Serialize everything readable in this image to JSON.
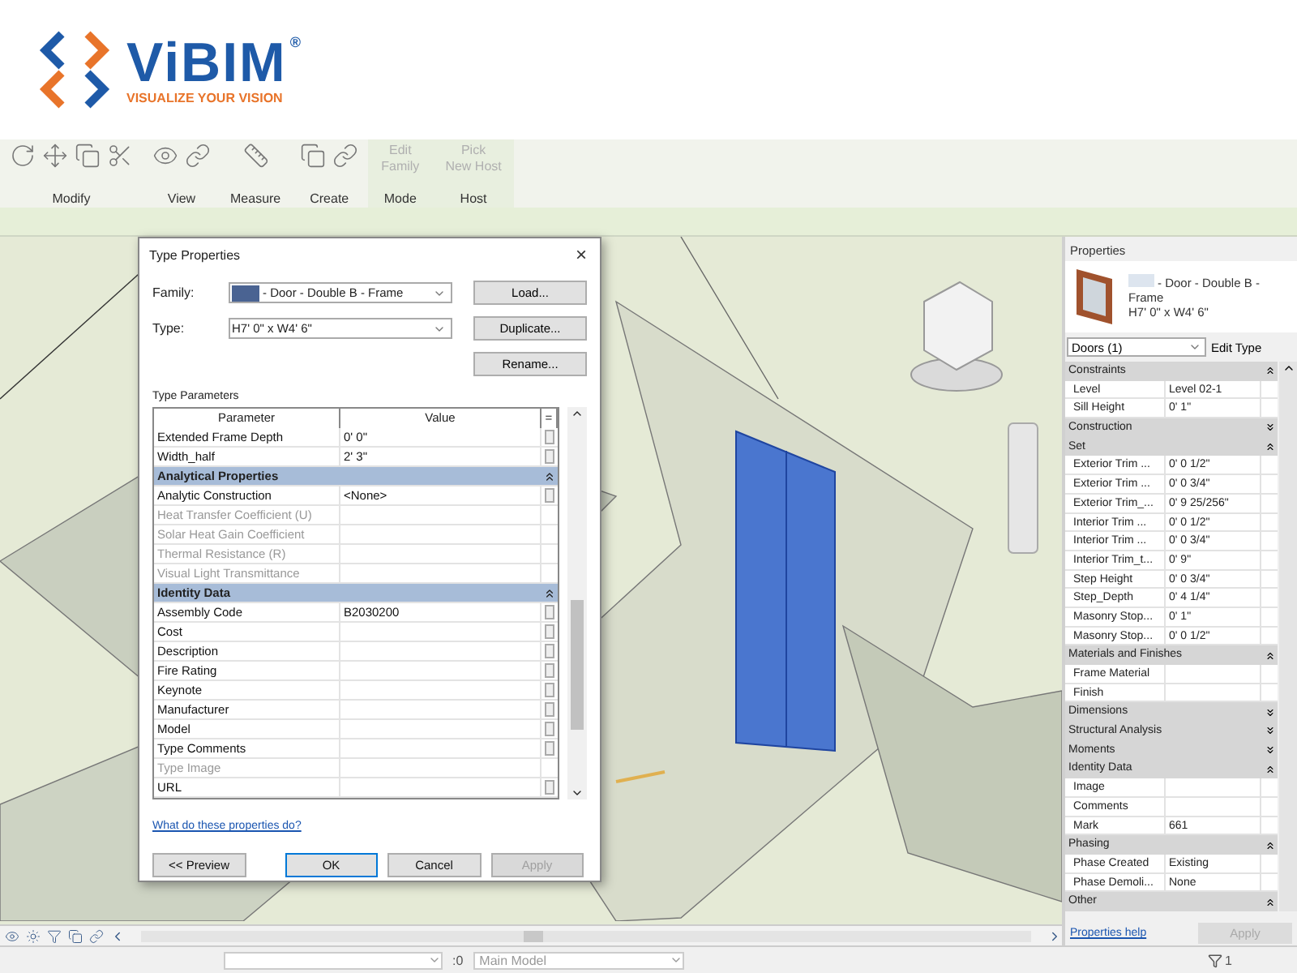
{
  "logo": {
    "name": "ViBIM",
    "mark": "®",
    "tagline": "VISUALIZE YOUR VISION"
  },
  "ribbon": {
    "groups": [
      {
        "label": "Modify",
        "kind": "tools"
      },
      {
        "label": "View",
        "kind": "tools"
      },
      {
        "label": "Measure",
        "kind": "tools"
      },
      {
        "label": "Create",
        "kind": "tools"
      },
      {
        "label": "Mode",
        "kind": "command",
        "button": [
          "Edit",
          "Family"
        ],
        "disabled": true
      },
      {
        "label": "Host",
        "kind": "command",
        "button": [
          "Pick",
          "New Host"
        ],
        "disabled": true
      }
    ]
  },
  "dialog": {
    "title": "Type Properties",
    "close": "×",
    "family": {
      "label": "Family:",
      "value": "- Door - Double B - Frame"
    },
    "type": {
      "label": "Type:",
      "value": "H7' 0\" x W4' 6\""
    },
    "side_buttons": [
      "Load...",
      "Duplicate...",
      "Rename..."
    ],
    "section": "Type Parameters",
    "columns": [
      "Parameter",
      "Value",
      "="
    ],
    "rows": [
      {
        "kind": "param",
        "name": "Extended Frame Depth",
        "value": "0'  0\"",
        "disabled": false
      },
      {
        "kind": "param",
        "name": "Width_half",
        "value": "2'  3\"",
        "disabled": false
      },
      {
        "kind": "group",
        "name": "Analytical Properties",
        "expanded": true
      },
      {
        "kind": "param",
        "name": "Analytic Construction",
        "value": "<None>",
        "disabled": false
      },
      {
        "kind": "param",
        "name": "Heat Transfer Coefficient (U)",
        "value": "",
        "disabled": true
      },
      {
        "kind": "param",
        "name": "Solar Heat Gain Coefficient",
        "value": "",
        "disabled": true
      },
      {
        "kind": "param",
        "name": "Thermal Resistance (R)",
        "value": "",
        "disabled": true
      },
      {
        "kind": "param",
        "name": "Visual Light Transmittance",
        "value": "",
        "disabled": true
      },
      {
        "kind": "group",
        "name": "Identity Data",
        "expanded": true
      },
      {
        "kind": "param",
        "name": "Assembly Code",
        "value": "B2030200",
        "disabled": false
      },
      {
        "kind": "param",
        "name": "Cost",
        "value": "",
        "disabled": false
      },
      {
        "kind": "param",
        "name": "Description",
        "value": "",
        "disabled": false
      },
      {
        "kind": "param",
        "name": "Fire Rating",
        "value": "",
        "disabled": false
      },
      {
        "kind": "param",
        "name": "Keynote",
        "value": "",
        "disabled": false
      },
      {
        "kind": "param",
        "name": "Manufacturer",
        "value": "",
        "disabled": false
      },
      {
        "kind": "param",
        "name": "Model",
        "value": "",
        "disabled": false
      },
      {
        "kind": "param",
        "name": "Type Comments",
        "value": "",
        "disabled": false
      },
      {
        "kind": "param",
        "name": "Type Image",
        "value": "",
        "disabled": true
      },
      {
        "kind": "param",
        "name": "URL",
        "value": "",
        "disabled": false
      }
    ],
    "help_link": "What do these properties do?",
    "buttons": [
      {
        "label": "<< Preview",
        "kind": "normal",
        "disabled": false
      },
      {
        "label": "OK",
        "kind": "default",
        "disabled": false
      },
      {
        "label": "Cancel",
        "kind": "normal",
        "disabled": false
      },
      {
        "label": "Apply",
        "kind": "normal",
        "disabled": true
      }
    ]
  },
  "properties": {
    "title": "Properties",
    "type_name": "- Door - Double B -",
    "type_name_2": "Frame",
    "type_size": "H7' 0\" x W4' 6\"",
    "selector": "Doors (1)",
    "edit_type": "Edit Type",
    "rows": [
      {
        "kind": "group",
        "name": "Constraints",
        "expanded": true
      },
      {
        "kind": "param",
        "name": "Level",
        "value": "Level 02-1"
      },
      {
        "kind": "param",
        "name": "Sill Height",
        "value": "0'  1\""
      },
      {
        "kind": "group",
        "name": "Construction",
        "expanded": false
      },
      {
        "kind": "group",
        "name": "Set",
        "expanded": true
      },
      {
        "kind": "param",
        "name": "Exterior Trim ...",
        "value": "0'  0 1/2\""
      },
      {
        "kind": "param",
        "name": "Exterior Trim ...",
        "value": "0'  0 3/4\""
      },
      {
        "kind": "param",
        "name": "Exterior Trim_...",
        "value": "0'  9 25/256\""
      },
      {
        "kind": "param",
        "name": "Interior Trim ...",
        "value": "0'  0 1/2\""
      },
      {
        "kind": "param",
        "name": "Interior Trim ...",
        "value": "0'  0 3/4\""
      },
      {
        "kind": "param",
        "name": "Interior Trim_t...",
        "value": "0'  9\""
      },
      {
        "kind": "param",
        "name": "Step Height",
        "value": "0'  0 3/4\""
      },
      {
        "kind": "param",
        "name": "Step_Depth",
        "value": "0'  4 1/4\""
      },
      {
        "kind": "param",
        "name": "Masonry Stop...",
        "value": "0'  1\""
      },
      {
        "kind": "param",
        "name": "Masonry Stop...",
        "value": "0'  0 1/2\""
      },
      {
        "kind": "group",
        "name": "Materials and Finishes",
        "expanded": true
      },
      {
        "kind": "param",
        "name": "Frame Material",
        "value": ""
      },
      {
        "kind": "param",
        "name": "Finish",
        "value": ""
      },
      {
        "kind": "group",
        "name": "Dimensions",
        "expanded": false
      },
      {
        "kind": "group",
        "name": "Structural Analysis",
        "expanded": false
      },
      {
        "kind": "group",
        "name": "Moments",
        "expanded": false
      },
      {
        "kind": "group",
        "name": "Identity Data",
        "expanded": true
      },
      {
        "kind": "param",
        "name": "Image",
        "value": ""
      },
      {
        "kind": "param",
        "name": "Comments",
        "value": ""
      },
      {
        "kind": "param",
        "name": "Mark",
        "value": "661"
      },
      {
        "kind": "group",
        "name": "Phasing",
        "expanded": true
      },
      {
        "kind": "param",
        "name": "Phase Created",
        "value": "Existing"
      },
      {
        "kind": "param",
        "name": "Phase Demoli...",
        "value": "None"
      },
      {
        "kind": "group",
        "name": "Other",
        "expanded": true
      }
    ],
    "help_link": "Properties help",
    "apply": {
      "label": "Apply",
      "disabled": true
    }
  },
  "status_bar": {
    "workset_count": ":0",
    "model": "Main Model",
    "filter_count": "1"
  }
}
